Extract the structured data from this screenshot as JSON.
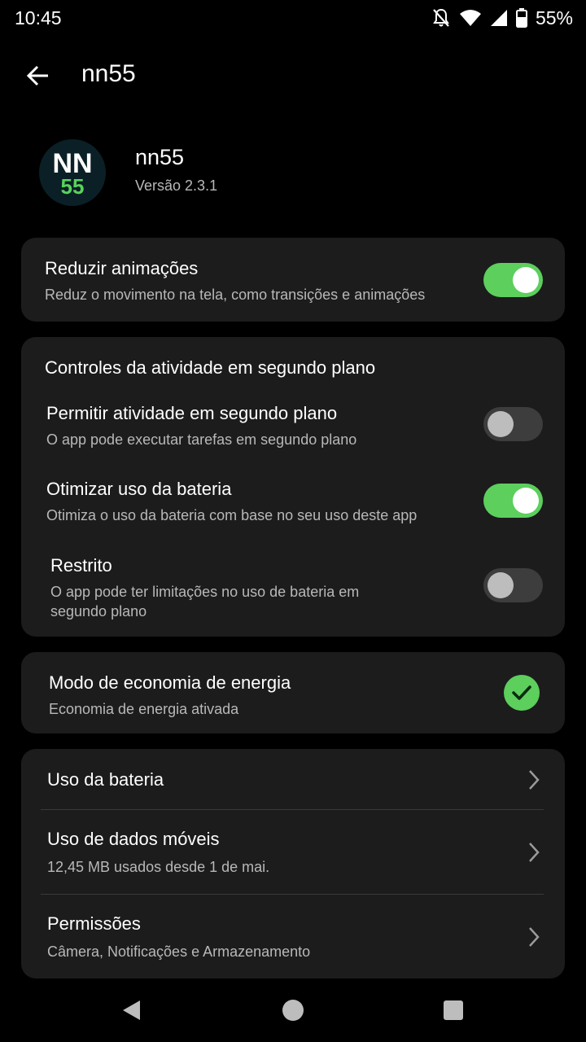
{
  "status_bar": {
    "time": "10:45",
    "battery_percent": "55%",
    "icons": [
      "bell-off-icon",
      "wifi-icon",
      "cell-signal-icon",
      "battery-icon"
    ]
  },
  "app_bar": {
    "title": "nn55"
  },
  "app_info": {
    "icon_line1": "NN",
    "icon_line2": "55",
    "name": "nn55",
    "version": "Versão 2.3.1"
  },
  "reduce_animations": {
    "title": "Reduzir animações",
    "subtitle": "Reduz o movimento na tela, como transições e animações",
    "enabled": true
  },
  "background_controls": {
    "section_title": "Controles da atividade em segundo plano",
    "items": [
      {
        "title": "Permitir atividade em segundo plano",
        "subtitle": "O app pode executar tarefas em segundo plano",
        "enabled": false
      },
      {
        "title": "Otimizar uso da bateria",
        "subtitle": "Otimiza o uso da bateria com base no seu uso deste app",
        "enabled": true
      },
      {
        "title": "Restrito",
        "subtitle_line1": "O app pode ter limitações no uso de bateria em",
        "subtitle_line2": "segundo plano",
        "enabled": false
      }
    ]
  },
  "power_saving": {
    "title": "Modo de economia de energia",
    "subtitle": "Economia de energia ativada",
    "checked": true
  },
  "links": [
    {
      "title": "Uso da bateria"
    },
    {
      "title": "Uso de dados móveis",
      "subtitle": "12,45 MB usados desde 1 de mai."
    },
    {
      "title": "Permissões",
      "subtitle": "Câmera, Notificações e Armazenamento"
    }
  ],
  "colors": {
    "background": "#000000",
    "card": "#1c1c1c",
    "accent_green": "#5ccf5c",
    "secondary_text": "#b8b8b8"
  }
}
